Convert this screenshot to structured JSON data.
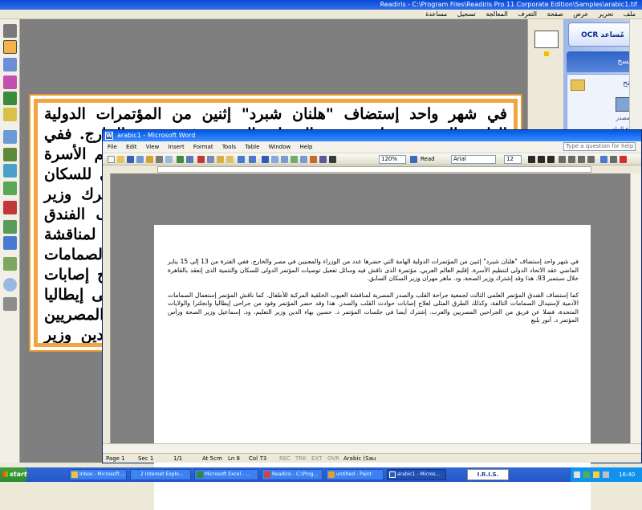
{
  "readiris": {
    "title": "Readiris - C:\\Program Files\\Readiris Pro 11 Corporate Edition\\Samples\\arabic1.tif",
    "menu": [
      "ملف",
      "تحرير",
      "عرض",
      "صفحة",
      "التعرف",
      "المعالجة",
      "تسجيل",
      "مساعدة"
    ],
    "ocr_button": "OCR مُساعد",
    "scan_label": "مسح",
    "open_label": "فتح",
    "source_label": "المصدر",
    "file_type_label": "نوع الملف",
    "arabic_text": "في شهر واحد إستضاف \"هلنان شبرد\" إثنين من المؤتمرات الدولية الهامة، التى حضرها عدد من الوزراء والمعنيين في مصر والخارج. ففي الفترة من ١٣ إلى ١٥ يناير الماضي عقد الاتحاد الدولى لتنظيم الأسرة مؤتمرة الذى ناقش فيه وسائل تفعيل توصيات المؤتمر الدولى للسكان والتنمية الذى إنعقد بالقاهرة خلال سبتمبر ٩٣. هذا وقد اشترك وزير الصحة، د. ماهر مهران وزير السكان السابق. كما إستضاف الفندق المؤتمر العلمى الثالث لجمعية جراحة القلب والصدر المصرية لمناقشة العيوب الخلقية المركبة للأطفال. كما ناقش المؤتمر إستعمال الصمامات الآدمية لإستبدال الصمامات التالفة، وكذلك الطرق المثلى لعلاج إصابات حوادث القلب والصدر. هذا وقد حضر المؤتمر وفود من جراحى إيطاليا وانجلترا والولايات المتحدة، فضلا عن فريق من الجراحين المصريين والعرب. إشترك أيضا فى جلسات المؤتمر د. حسين بهاء الدين وزير التعليم، ود. إسماعيل سلام وزير الصحة ورأس المؤتمر د. أنور بلبع."
  },
  "word": {
    "title": "arabic1 - Microsoft Word",
    "menu": [
      "File",
      "Edit",
      "View",
      "Insert",
      "Format",
      "Tools",
      "Table",
      "Window",
      "Help"
    ],
    "help_placeholder": "Type a question for help",
    "zoom": "120%",
    "read_label": "Read",
    "font_name": "Arial",
    "font_size": "12",
    "paragraph1": "في شهر واحد إستضاف \"هلنان شبرد\" إثنين من المؤتمرات الدولية الهامة التي حضرها عدد من الوزراء والمعنيين في مصر والخارج. ففي الفترة من 13 إلى 15 يناير الماضي عقد الاتحاد الدولى لتنظيم الأسرة. إقليم العالم العربي. مؤتمرة الذى ناقش فيه وسائل تفعيل توصيات المؤتمر الدولى للسكان والتنمية الذى إنعقد بالقاهرة خلال سبتمبر 93. هذا وقد إشترك وزير الصحة، ود. ماهر مهران وزير السكان السابق.",
    "paragraph2": "كما إستضاف الفندق المؤتمر العلمى الثالث لجمعية جراحة القلب والصدر المصرية لمناقشة العيوب الخلقية المركبة للأطفال. كما ناقش المؤتمر إستعمال الصمامات الآدمية لإستبدال الصمامات التالفة، وكذلك الطرق المثلى لعلاج إصابات حوادث القلب والصدر. هذا وقد حضر المؤتمر وفود من جراحى إيطاليا وانجلترا والولايات المتحدة، فضلا عن فريق من الجراحين المصريين والعرب. إشترك أيضا فى جلسات المؤتمر د. حسين بهاء الدين وزير التعليم، ود. إسماعيل وزير الصحة ورأس المؤتمر د. أنور بلبع",
    "status": {
      "page": "Page 1",
      "sec": "Sec 1",
      "pages": "1/1",
      "at": "At 5cm",
      "ln": "Ln 8",
      "col": "Col 73",
      "rec": "REC",
      "trk": "TRK",
      "ext": "EXT",
      "ovr": "OVR",
      "language": "Arabic (Sau"
    }
  },
  "taskbar": {
    "start": "start",
    "tasks": [
      "Inbox - Microsoft ...",
      "2 Internet Explo...",
      "Microsoft Excel - ...",
      "Readiris - C:\\Prog...",
      "untitled - Paint",
      "arabic1 - Micros..."
    ],
    "iris": "I.R.I.S.",
    "clock": "16:40"
  },
  "colors": {
    "xp_blue": "#245edb",
    "readiris_frame": "#f0a540"
  }
}
